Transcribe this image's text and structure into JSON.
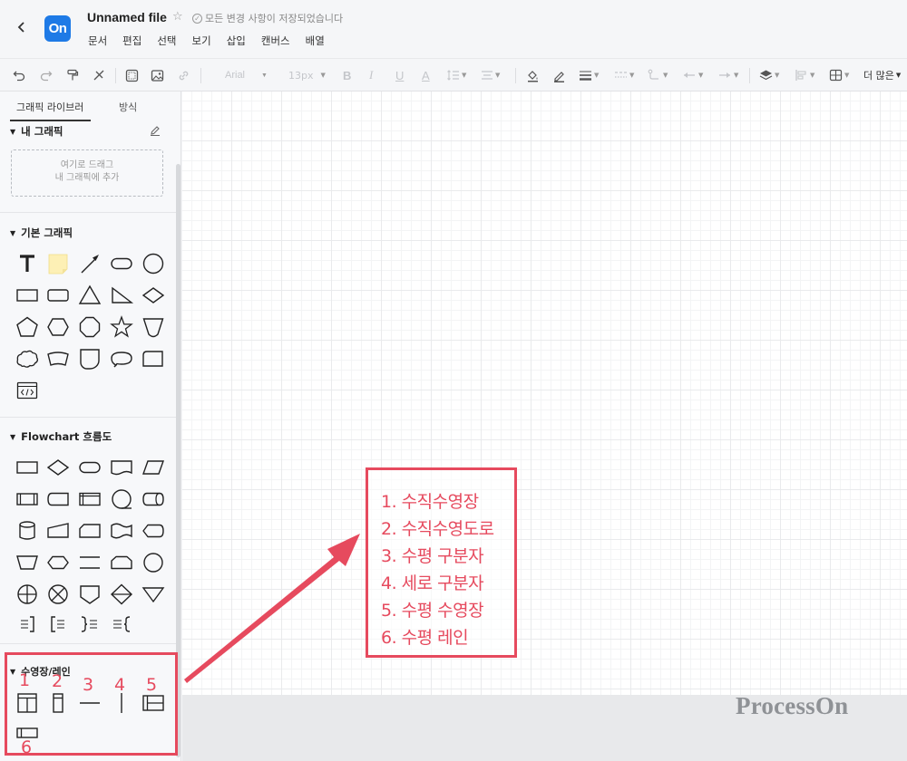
{
  "header": {
    "back_icon": "chevron-left-icon",
    "logo_text": "On",
    "file_name": "Unnamed file",
    "saved_status": "모든 변경 사항이 저장되었습니다",
    "menu": [
      "문서",
      "편집",
      "선택",
      "보기",
      "삽입",
      "캔버스",
      "배열"
    ]
  },
  "toolbar": {
    "font_family": "Arial",
    "font_size": "13px",
    "more_label": "더 많은"
  },
  "sidebar": {
    "tabs": [
      "그래픽 라이브러",
      "방식"
    ],
    "my_graphics": {
      "title": "내 그래픽",
      "drop_line1": "여기로 드래그",
      "drop_line2": "내 그래픽에 추가"
    },
    "basic_title": "기본 그래픽",
    "flowchart_title": "Flowchart 흐름도",
    "swimlane_title": "수영장/레인"
  },
  "annotation": {
    "items": [
      "1. 수직수영장",
      "2. 수직수영도로",
      "3. 수평 구분자",
      "4. 세로 구분자",
      "5. 수평 수영장",
      "6. 수평 레인"
    ],
    "lane_numbers": [
      "1",
      "2",
      "3",
      "4",
      "5",
      "6"
    ],
    "color": "#e64a5e"
  },
  "watermark": "ProcessOn",
  "colors": {
    "logo": "#1e7ae6",
    "note": "#fdf0b5"
  }
}
